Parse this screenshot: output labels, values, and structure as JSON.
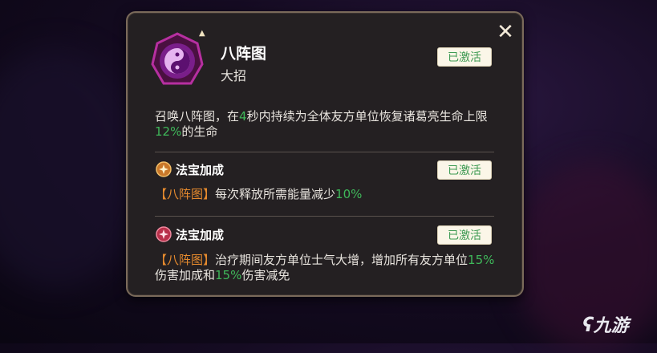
{
  "skill": {
    "name": "八阵图",
    "type": "大招",
    "status": "已激活",
    "description": {
      "p1": "召唤八阵图，在",
      "seconds": "4",
      "p2": "秒内持续为全体友方单位恢复诸葛亮生命上限",
      "percent": "12%",
      "p3": "的生命"
    }
  },
  "bonus1": {
    "title": "法宝加成",
    "status": "已激活",
    "tag": "【八阵图】",
    "text": "每次释放所需能量减少",
    "percent": "10%"
  },
  "bonus2": {
    "title": "法宝加成",
    "status": "已激活",
    "tag": "【八阵图】",
    "text": "治疗期间友方单位士气大增，增加所有友方单位",
    "percent1": "15%",
    "text2": "伤害加成和",
    "percent2": "15%",
    "text3": "伤害减免"
  },
  "icons": {
    "close": "close-icon",
    "skill": "yin-yang-icon",
    "upgrade": "up-arrow-icon",
    "bonus1": "gold-treasure-icon",
    "bonus2": "red-treasure-icon"
  },
  "watermark": "九游",
  "colors": {
    "highlight_green": "#3fb85a",
    "tag_orange": "#e58a2e",
    "badge_text": "#3d9a52",
    "badge_bg": "#fbf6e8"
  }
}
